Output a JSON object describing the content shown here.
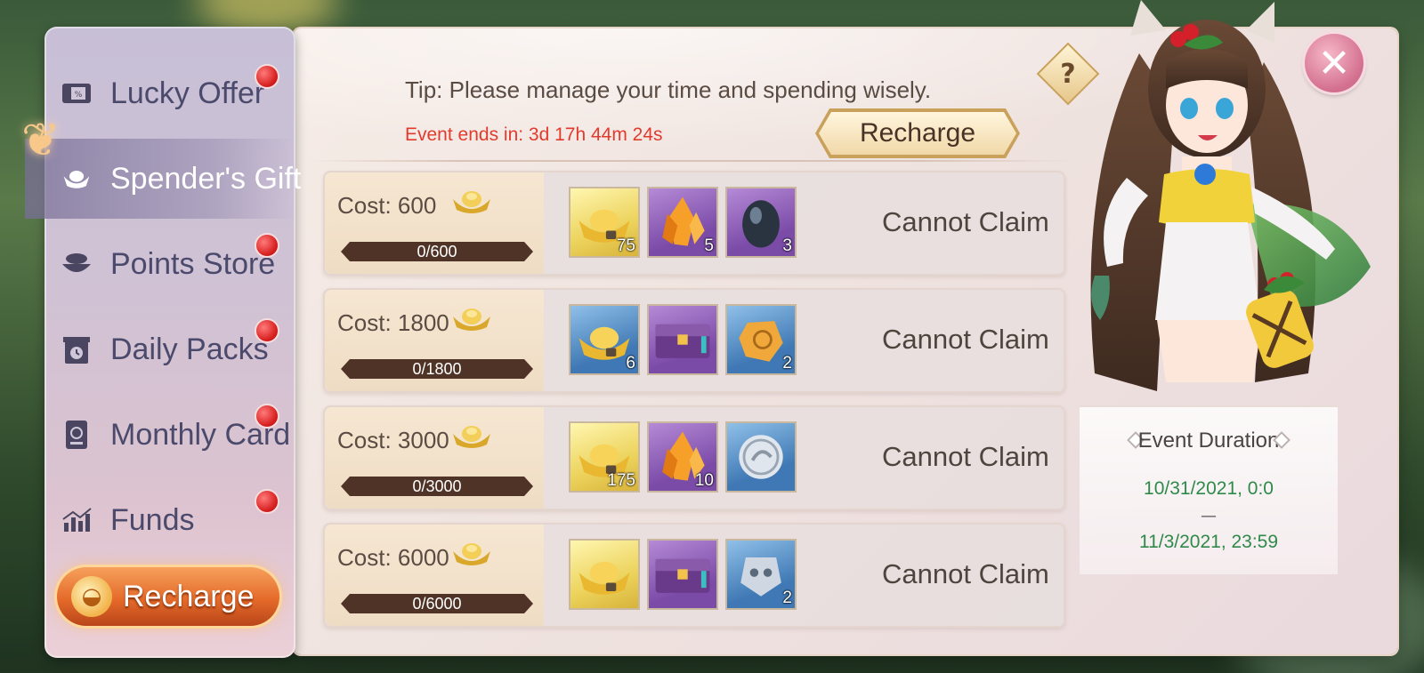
{
  "sidebar": {
    "items": [
      {
        "label": "Lucky Offer",
        "icon": "ticket-icon",
        "badge": true,
        "active": false
      },
      {
        "label": "Spender's Gift",
        "icon": "ingot-icon",
        "badge": false,
        "active": true
      },
      {
        "label": "Points Store",
        "icon": "bowl-icon",
        "badge": true,
        "active": false
      },
      {
        "label": "Daily Packs",
        "icon": "gift-clock-icon",
        "badge": true,
        "active": false
      },
      {
        "label": "Monthly Card",
        "icon": "card-icon",
        "badge": true,
        "active": false
      },
      {
        "label": "Funds",
        "icon": "chart-icon",
        "badge": true,
        "active": false
      }
    ],
    "recharge_label": "Recharge"
  },
  "header": {
    "tip": "Tip: Please manage your time and spending wisely.",
    "event_ends": "Event ends in: 3d 17h 44m 24s",
    "recharge_label": "Recharge",
    "help_label": "?"
  },
  "rewards": [
    {
      "cost_label": "Cost: 600",
      "progress_label": "0/600",
      "status": "Cannot Claim",
      "items": [
        {
          "type": "gold-ingot",
          "qty": "75"
        },
        {
          "type": "orange-crystal",
          "qty": "5"
        },
        {
          "type": "dark-egg",
          "qty": "3"
        }
      ]
    },
    {
      "cost_label": "Cost: 1800",
      "progress_label": "0/1800",
      "status": "Cannot Claim",
      "items": [
        {
          "type": "gold-ingot-blue",
          "qty": "6"
        },
        {
          "type": "purple-chest",
          "qty": ""
        },
        {
          "type": "amber-stone",
          "qty": "2"
        }
      ]
    },
    {
      "cost_label": "Cost: 3000",
      "progress_label": "0/3000",
      "status": "Cannot Claim",
      "items": [
        {
          "type": "gold-ingot",
          "qty": "175"
        },
        {
          "type": "orange-crystal",
          "qty": "10"
        },
        {
          "type": "silver-coin",
          "qty": ""
        }
      ]
    },
    {
      "cost_label": "Cost: 6000",
      "progress_label": "0/6000",
      "status": "Cannot Claim",
      "items": [
        {
          "type": "gold-ingot",
          "qty": ""
        },
        {
          "type": "purple-chest",
          "qty": ""
        },
        {
          "type": "silver-mask",
          "qty": "2"
        }
      ]
    }
  ],
  "duration": {
    "title": "Event Duration",
    "start": "10/31/2021, 0:0",
    "separator": "—",
    "end": "11/3/2021, 23:59"
  },
  "colors": {
    "accent_red": "#e23b2e",
    "date_green": "#2f8a4a",
    "badge_red": "#d71f1f"
  }
}
